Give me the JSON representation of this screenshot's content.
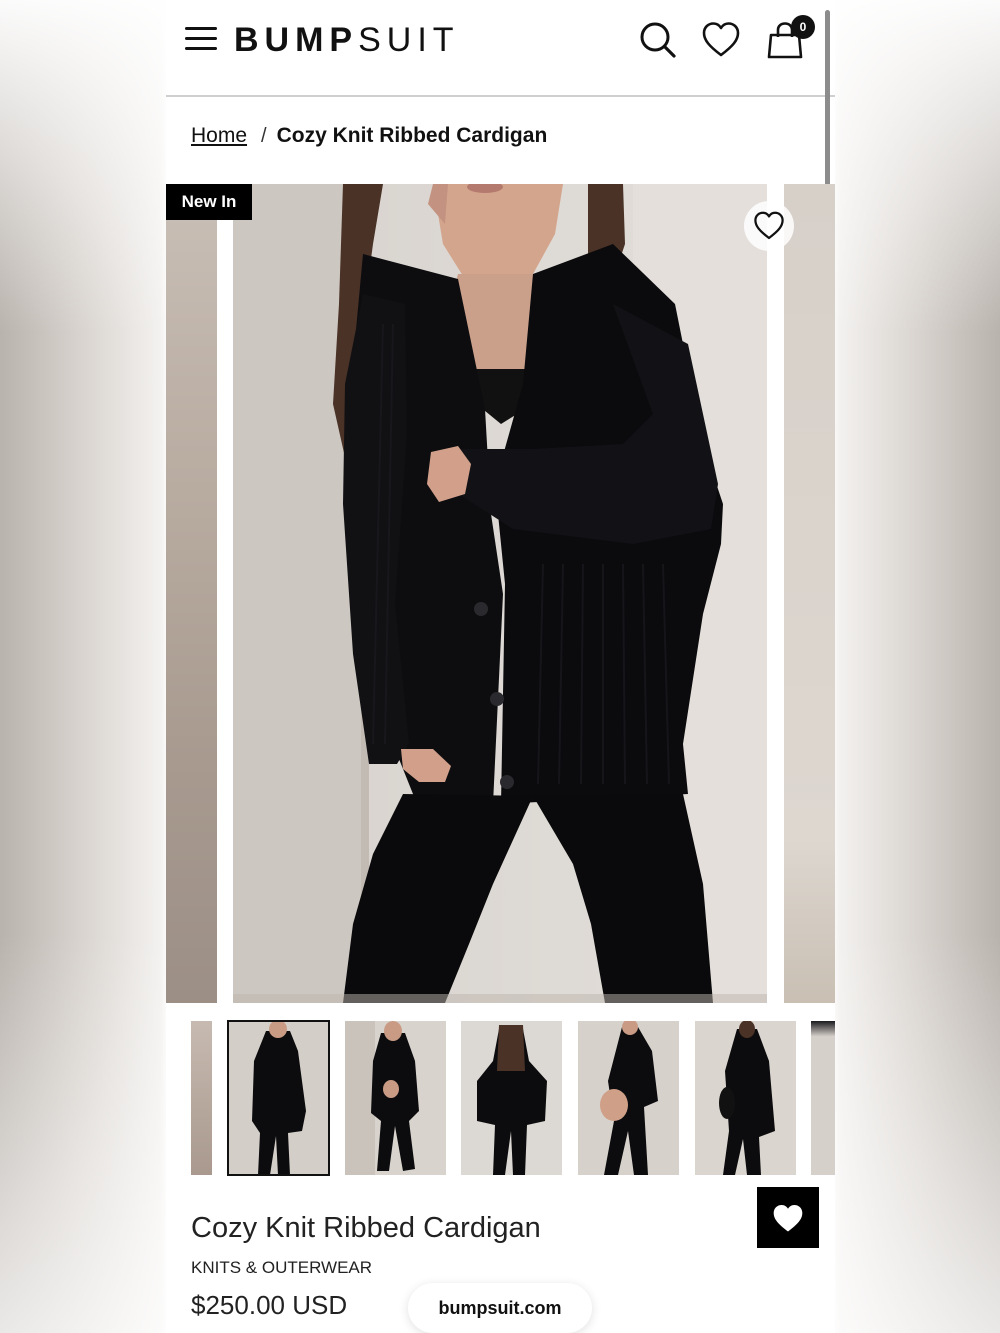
{
  "header": {
    "logo_bold": "BUMP",
    "logo_light": "SUIT",
    "cart_count": "0"
  },
  "breadcrumb": {
    "home": "Home",
    "separator": "/",
    "current": "Cozy Knit Ribbed Cardigan"
  },
  "gallery": {
    "badge": "New In",
    "thumbnail_count": 7,
    "active_thumbnail": 1
  },
  "product": {
    "title": "Cozy Knit Ribbed Cardigan",
    "category": "KNITS & OUTERWEAR",
    "price": "$250.00 USD"
  },
  "browser": {
    "url": "bumpsuit.com"
  },
  "icons": {
    "menu": "hamburger-icon",
    "search": "search-icon",
    "wishlist": "heart-icon",
    "cart": "shopping-bag-icon",
    "floating_wishlist": "heart-filled-icon"
  },
  "colors": {
    "text": "#111111",
    "badge_bg": "#000000",
    "garment": "#0c0c0e",
    "wall": "#dcd7d2"
  }
}
